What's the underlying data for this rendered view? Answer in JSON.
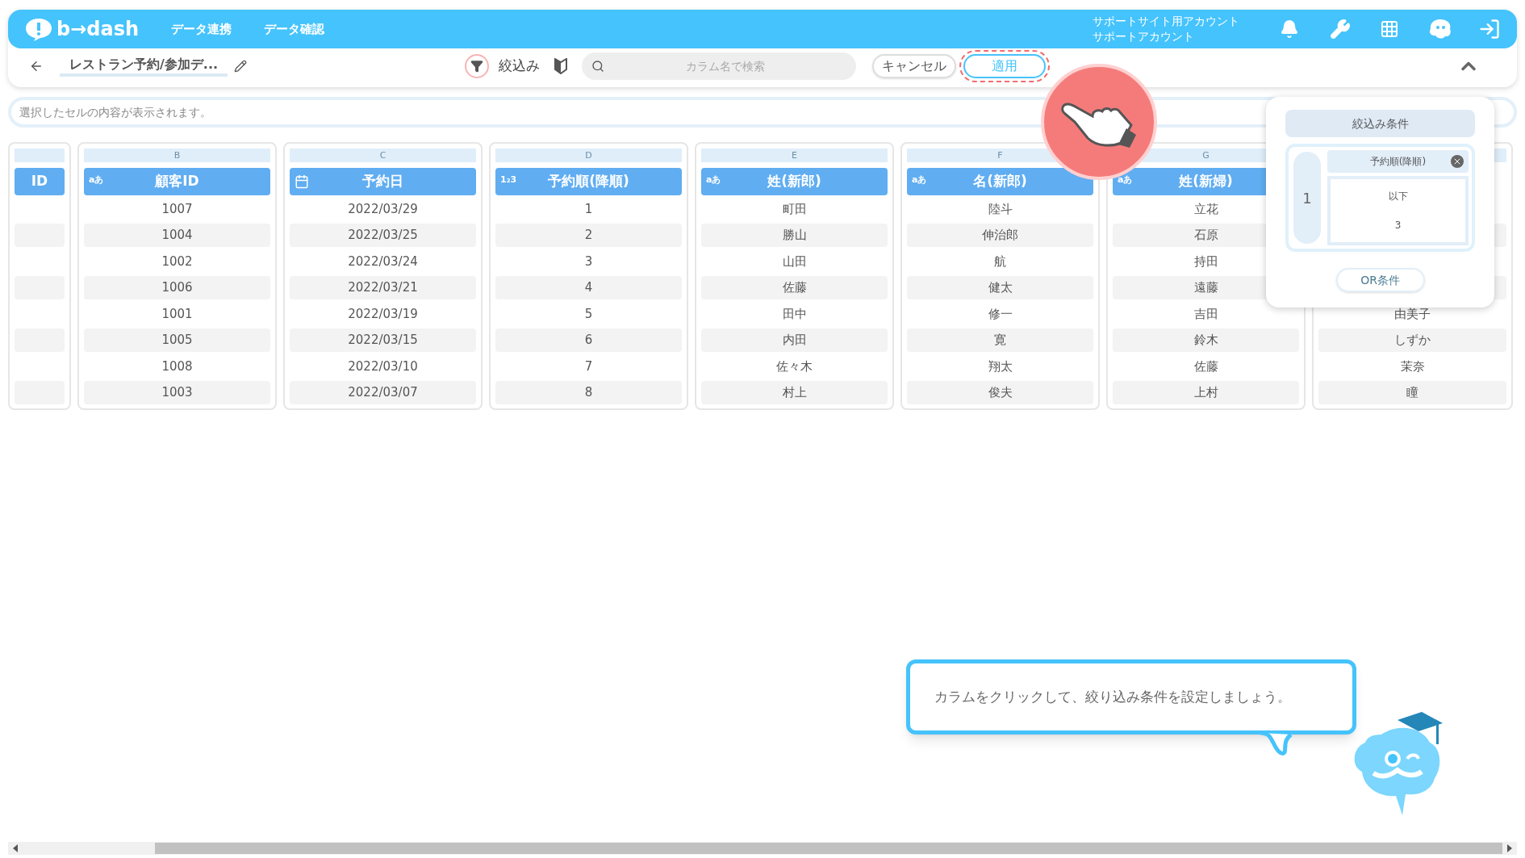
{
  "header": {
    "logo": "b→dash",
    "nav": [
      {
        "label": "データ連携"
      },
      {
        "label": "データ確認"
      }
    ],
    "account": [
      "サポートサイト用アカウント",
      "サポートアカウント"
    ]
  },
  "toolbar": {
    "title": "レストラン予約/参加デ...",
    "filter_label": "絞込み",
    "search": {
      "placeholder": "カラム名で検索"
    },
    "cancel": "キャンセル",
    "apply": "適用"
  },
  "cell_bar": {
    "placeholder": "選択したセルの内容が表示されます。"
  },
  "columns": [
    {
      "title": "ID",
      "kind": "text",
      "cells": [
        null,
        null,
        null,
        null,
        null,
        null,
        null,
        null
      ]
    },
    {
      "letter": "B",
      "title": "顧客ID",
      "kind": "text",
      "type_label": "aあ",
      "cells": [
        "1007",
        "1004",
        "1002",
        "1006",
        "1001",
        "1005",
        "1008",
        "1003"
      ]
    },
    {
      "letter": "C",
      "title": "予約日",
      "kind": "date",
      "cells": [
        "2022/03/29",
        "2022/03/25",
        "2022/03/24",
        "2022/03/21",
        "2022/03/19",
        "2022/03/15",
        "2022/03/10",
        "2022/03/07"
      ]
    },
    {
      "letter": "D",
      "title": "予約順(降順)",
      "kind": "text",
      "type_label": "1₂3",
      "cells": [
        "1",
        "2",
        "3",
        "4",
        "5",
        "6",
        "7",
        "8"
      ]
    },
    {
      "letter": "E",
      "title": "姓(新郎)",
      "kind": "text",
      "type_label": "aあ",
      "cells": [
        "町田",
        "勝山",
        "山田",
        "佐藤",
        "田中",
        "内田",
        "佐々木",
        "村上"
      ]
    },
    {
      "letter": "F",
      "title": "名(新郎)",
      "kind": "text",
      "type_label": "aあ",
      "cells": [
        "陸斗",
        "伸治郎",
        "航",
        "健太",
        "修一",
        "寛",
        "翔太",
        "俊夫"
      ]
    },
    {
      "letter": "G",
      "title": "姓(新婦)",
      "kind": "text",
      "type_label": "aあ",
      "cells": [
        "立花",
        "石原",
        "持田",
        "遠藤",
        "吉田",
        "鈴木",
        "佐藤",
        "上村"
      ]
    },
    {
      "cells": [
        null,
        null,
        null,
        null,
        "由美子",
        "しずか",
        "茉奈",
        "瞳"
      ]
    }
  ],
  "filter_panel": {
    "title": "絞込み条件",
    "conditions": [
      {
        "index": "1",
        "column": "予約順(降順)",
        "operator": "以下",
        "value": "3"
      }
    ],
    "or_button": "OR条件"
  },
  "tutorial": {
    "message": "カラムをクリックして、絞り込み条件を設定しましょう。"
  }
}
